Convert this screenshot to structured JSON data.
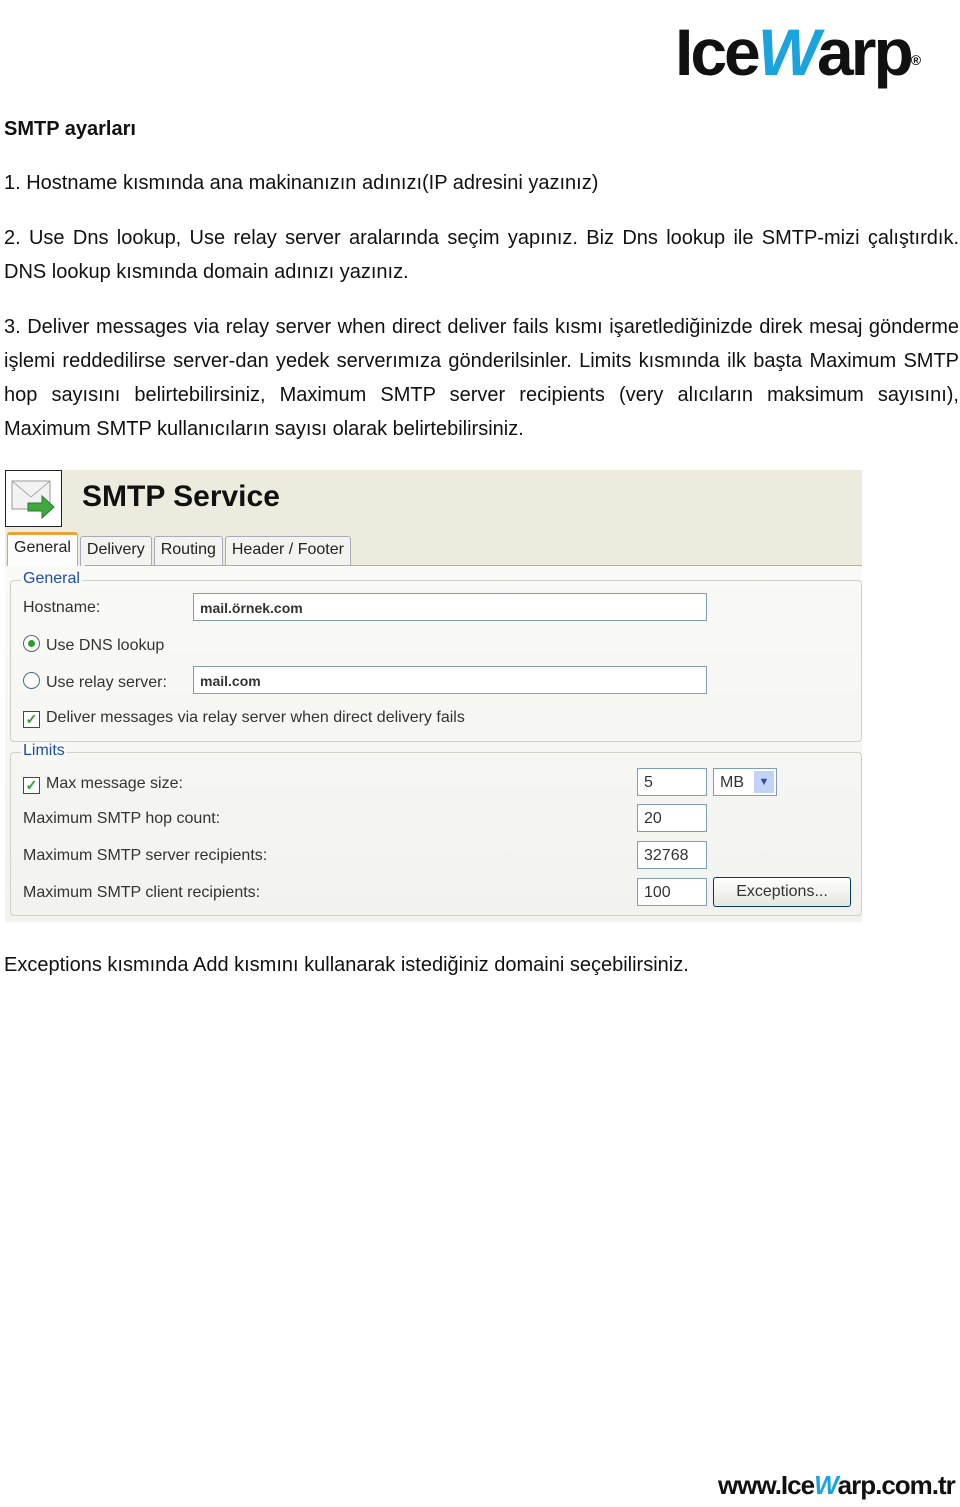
{
  "logo": {
    "pre": "Ice",
    "w": "W",
    "post": "arp",
    "reg": "®"
  },
  "doc": {
    "heading": "SMTP ayarları",
    "p1": "1. Hostname kısmında ana makinanızın adınızı(IP adresini yazınız)",
    "p2": "2. Use Dns lookup, Use relay server aralarında seçim yapınız. Biz Dns lookup ile SMTP-mizi çalıştırdık. DNS lookup kısmında domain adınızı yazınız.",
    "p3": "3. Deliver messages via relay server when direct deliver fails kısmı işaretlediğinizde direk mesaj gönderme işlemi reddedilirse server-dan yedek serverımıza gönderilsinler. Limits kısmında ilk başta Maximum SMTP hop sayısını belirtebilirsiniz, Maximum SMTP server recipients (very alıcıların maksimum sayısını), Maximum SMTP kullanıcıların sayısı olarak belirtebilirsiniz.",
    "p4": "Exceptions kısmında Add kısmını kullanarak istediğiniz domaini seçebilirsiniz."
  },
  "screenshot": {
    "title": "SMTP Service",
    "tabs": [
      "General",
      "Delivery",
      "Routing",
      "Header / Footer"
    ],
    "active_tab": "General",
    "general": {
      "legend": "General",
      "hostname_label": "Hostname:",
      "hostname_value": "mail.örnek.com",
      "dns_label": "Use DNS lookup",
      "relay_label": "Use relay server:",
      "relay_value": "mail.com",
      "selected": "Use DNS lookup",
      "deliver_label": "Deliver messages via relay server when direct delivery fails",
      "deliver_checked": true
    },
    "limits": {
      "legend": "Limits",
      "max_size_label": "Max message size:",
      "max_size_checked": true,
      "max_size_value": "5",
      "max_size_unit": "MB",
      "hop_label": "Maximum SMTP hop count:",
      "hop_value": "20",
      "server_rcpt_label": "Maximum SMTP server recipients:",
      "server_rcpt_value": "32768",
      "client_rcpt_label": "Maximum SMTP client recipients:",
      "client_rcpt_value": "100",
      "exceptions_button": "Exceptions..."
    }
  },
  "footer": {
    "pre": "www.Ice",
    "w": "W",
    "post": "arp",
    "tld": ".com.tr"
  }
}
